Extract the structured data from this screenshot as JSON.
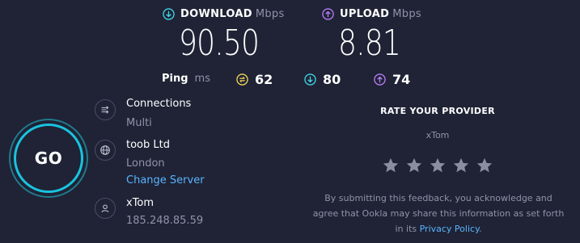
{
  "download": {
    "label": "DOWNLOAD",
    "unit": "Mbps",
    "value": "90.50",
    "icon": "download-arrow-icon",
    "color": "#40d6e8"
  },
  "upload": {
    "label": "UPLOAD",
    "unit": "Mbps",
    "value": "8.81",
    "icon": "upload-arrow-icon",
    "color": "#b87df5"
  },
  "ping": {
    "label": "Ping",
    "unit": "ms",
    "idle": "62",
    "download": "80",
    "upload": "74",
    "idle_color": "#f5d65a"
  },
  "go_button": {
    "label": "GO",
    "ring_color": "#19c3df"
  },
  "connections": {
    "title": "Connections",
    "value": "Multi",
    "icon": "connections-icon"
  },
  "server": {
    "title": "toob Ltd",
    "location": "London",
    "change_link": "Change Server",
    "icon": "globe-icon"
  },
  "user": {
    "title": "xTom",
    "ip": "185.248.85.59",
    "icon": "user-icon"
  },
  "rate": {
    "title": "RATE YOUR PROVIDER",
    "provider": "xTom",
    "stars": 5,
    "rating": 0,
    "disclaimer_line1": "By submitting this feedback, you acknowledge and",
    "disclaimer_line2": "agree that Ookla may share this information as set forth",
    "disclaimer_pre": "in its",
    "privacy_link": "Privacy Policy",
    "disclaimer_post": "."
  },
  "colors": {
    "background": "#1f2335",
    "link": "#5ab4ff",
    "muted": "#9193a8"
  }
}
